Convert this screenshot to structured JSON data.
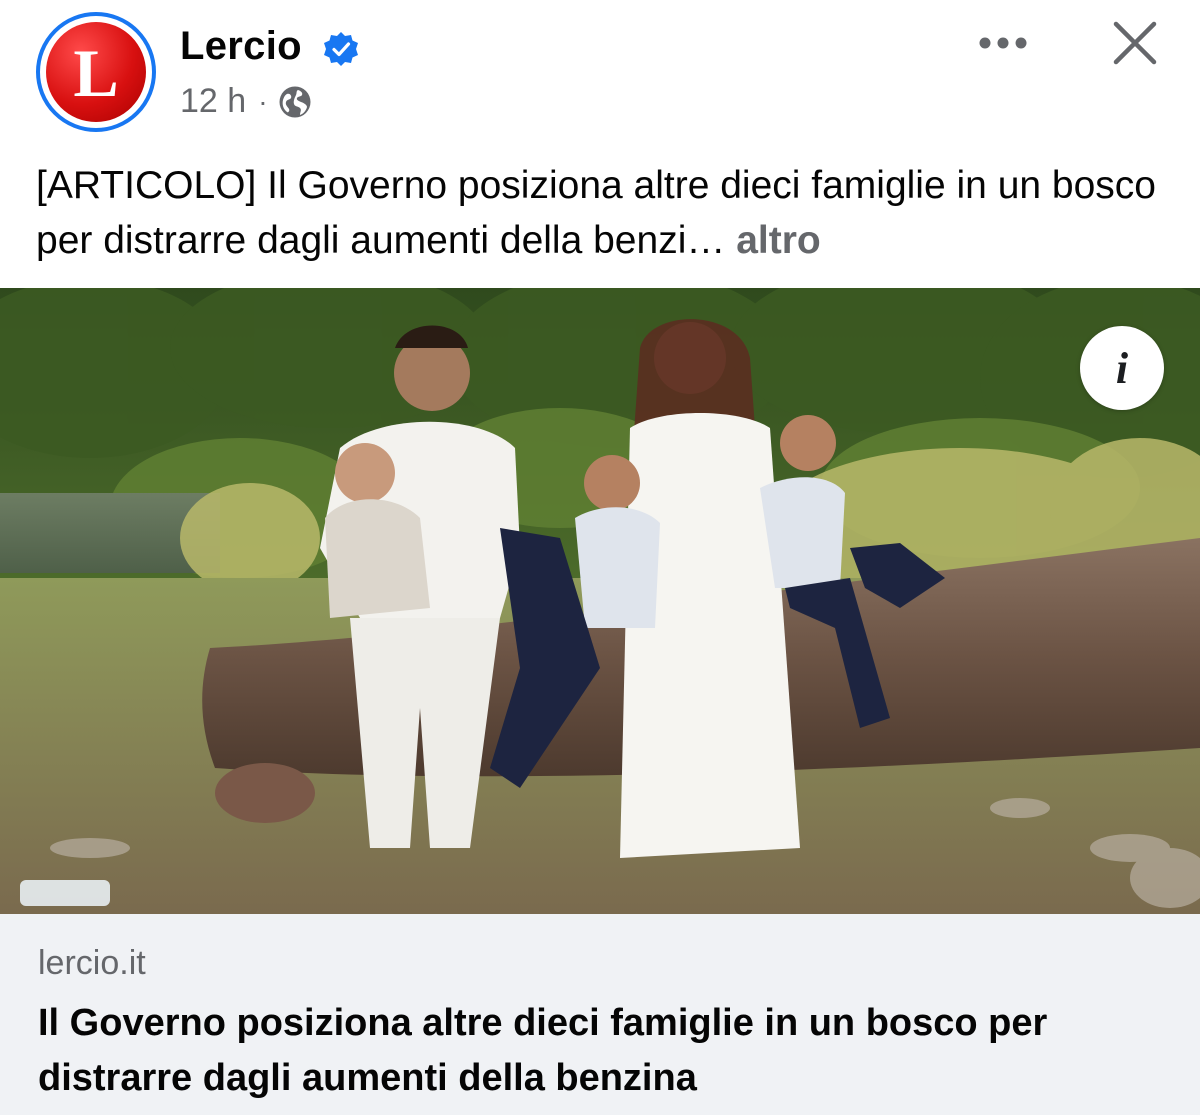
{
  "header": {
    "avatar_letter": "L",
    "page_name": "Lercio",
    "time": "12 h",
    "separator": "·"
  },
  "post": {
    "text": "[ARTICOLO] Il Governo posiziona altre dieci famiglie in un bosco per distrarre dagli aumenti della benzi…",
    "more_label": "altro"
  },
  "photo": {
    "info_label": "i"
  },
  "link_card": {
    "domain": "lercio.it",
    "title": "Il Governo posiziona altre dieci famiglie in un bosco per distrarre dagli aumenti della benzina"
  },
  "icons": {
    "verified": "verified-badge-icon",
    "audience": "globe-icon",
    "more": "more-options-icon",
    "close": "close-icon",
    "info": "info-icon"
  },
  "colors": {
    "accent": "#1877f2",
    "brand_red": "#d81010",
    "secondary_text": "#65676b",
    "card_background": "#f0f2f5"
  }
}
